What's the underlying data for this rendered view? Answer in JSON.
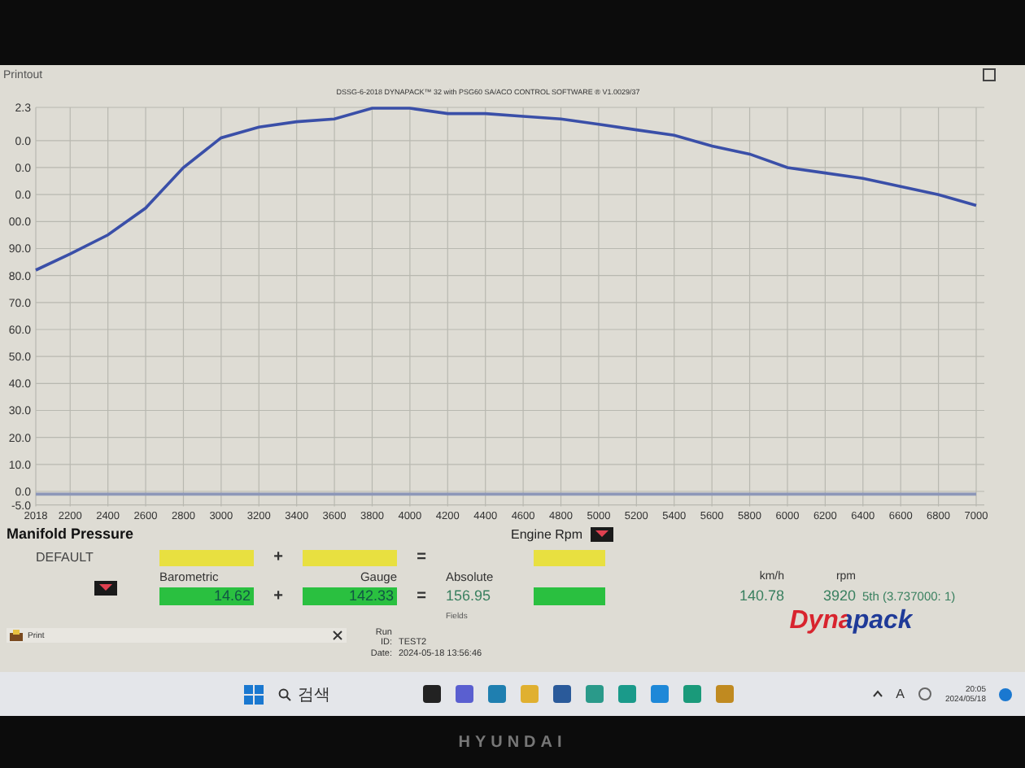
{
  "window": {
    "title": "Printout"
  },
  "chart": {
    "header": "DSSG-6-2018 DYNAPACK™ 32 with PSG60 SA/ACO CONTROL SOFTWARE ® V1.0029/37",
    "chart_data": {
      "type": "line",
      "x": [
        2018,
        2200,
        2400,
        2600,
        2800,
        3000,
        3200,
        3400,
        3600,
        3800,
        4000,
        4200,
        4400,
        4600,
        4800,
        5000,
        5200,
        5400,
        5600,
        5800,
        6000,
        6200,
        6400,
        6600,
        6800,
        7000
      ],
      "series": [
        {
          "color": "#3a4fa8",
          "values": [
            82,
            88,
            95,
            105,
            120,
            131,
            135,
            137,
            138,
            142,
            142,
            140,
            140,
            139,
            138,
            136,
            134,
            132,
            128,
            125,
            120,
            118,
            116,
            113,
            110,
            106
          ]
        },
        {
          "color": "#8d97b8",
          "values": [
            -1,
            -1,
            -1,
            -1,
            -1,
            -1,
            -1,
            -1,
            -1,
            -1,
            -1,
            -1,
            -1,
            -1,
            -1,
            -1,
            -1,
            -1,
            -1,
            -1,
            -1,
            -1,
            -1,
            -1,
            -1,
            -1
          ]
        }
      ],
      "xlim": [
        2018,
        7000
      ],
      "ylim": [
        -5,
        142.3
      ],
      "grid": true,
      "xticks": [
        {
          "value": 2018,
          "label": "2018"
        },
        2200,
        2400,
        2600,
        2800,
        3000,
        3200,
        3400,
        3600,
        3800,
        4000,
        4200,
        4400,
        4600,
        4800,
        5000,
        5200,
        5400,
        5600,
        5800,
        6000,
        6200,
        6400,
        6600,
        6800,
        7000
      ],
      "yticks": [
        {
          "value": 90,
          "label": "90.0"
        },
        {
          "value": 80,
          "label": "80.0"
        },
        {
          "value": 70,
          "label": "70.0"
        },
        {
          "value": 60,
          "label": "60.0"
        },
        {
          "value": 50,
          "label": "50.0"
        },
        {
          "value": 40,
          "label": "40.0"
        },
        {
          "value": 30,
          "label": "30.0"
        },
        {
          "value": 20,
          "label": "20.0"
        },
        {
          "value": 10,
          "label": "10.0"
        },
        {
          "value": 0,
          "label": "0.0"
        },
        {
          "value": -5,
          "label": "-5.0"
        }
      ]
    },
    "cut_axis_labels": [
      "2.3",
      "0.0",
      "0.0",
      "0.0",
      "00.0"
    ]
  },
  "panel": {
    "title": "Manifold Pressure",
    "x_axis_label": "Engine Rpm",
    "preset": "DEFAULT",
    "plus": "+",
    "equals": "=",
    "labels": [
      "Barometric",
      "Gauge",
      "Absolute"
    ],
    "values": [
      "14.62",
      "142.33",
      "156.95"
    ],
    "note": "Fields",
    "readouts": [
      {
        "unit": "km/h",
        "value": "140.78"
      },
      {
        "unit": "rpm",
        "value": "3920"
      }
    ],
    "gear": "5th (3.737000: 1)",
    "logo": "Dynapack"
  },
  "run": {
    "print_tab": "Print",
    "run_id_label": "Run ID:",
    "run_id": "TEST2",
    "date_label": "Date:",
    "date": "2024-05-18 13:56:46"
  },
  "taskbar": {
    "search": "검색",
    "ime": "A",
    "time": "20:05",
    "date": "2024/05/18"
  },
  "monitor": {
    "brand": "HYUNDAI"
  }
}
